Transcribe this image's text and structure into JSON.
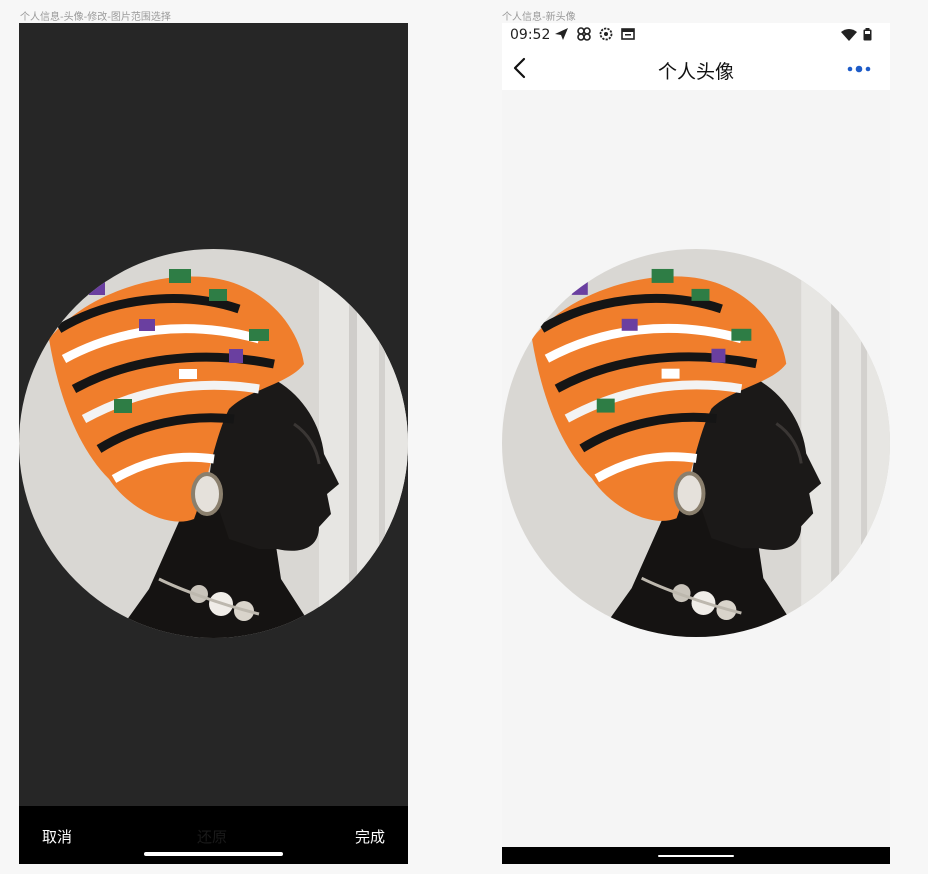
{
  "left_screen": {
    "caption": "个人信息-头像-修改-图片范围选择",
    "bottom_bar": {
      "cancel_label": "取消",
      "restore_label": "还原",
      "done_label": "完成"
    },
    "image": {
      "subject": "woman-in-headwrap-portrait"
    }
  },
  "right_screen": {
    "caption": "个人信息-新头像",
    "status_bar": {
      "time": "09:52",
      "icons_left": [
        "send-icon",
        "pinwheel-icon",
        "settings-icon",
        "calendar-icon"
      ],
      "icons_right": [
        "wifi-icon",
        "battery-icon"
      ]
    },
    "nav": {
      "title": "个人头像",
      "back_icon": "chevron-left-icon",
      "more_icon": "more-dots-icon"
    },
    "image": {
      "subject": "woman-in-headwrap-portrait"
    }
  },
  "colors": {
    "accent": "#1e5cc8",
    "crop_background": "#262626",
    "bar_black": "#000000",
    "page_background": "#f5f5f5"
  }
}
